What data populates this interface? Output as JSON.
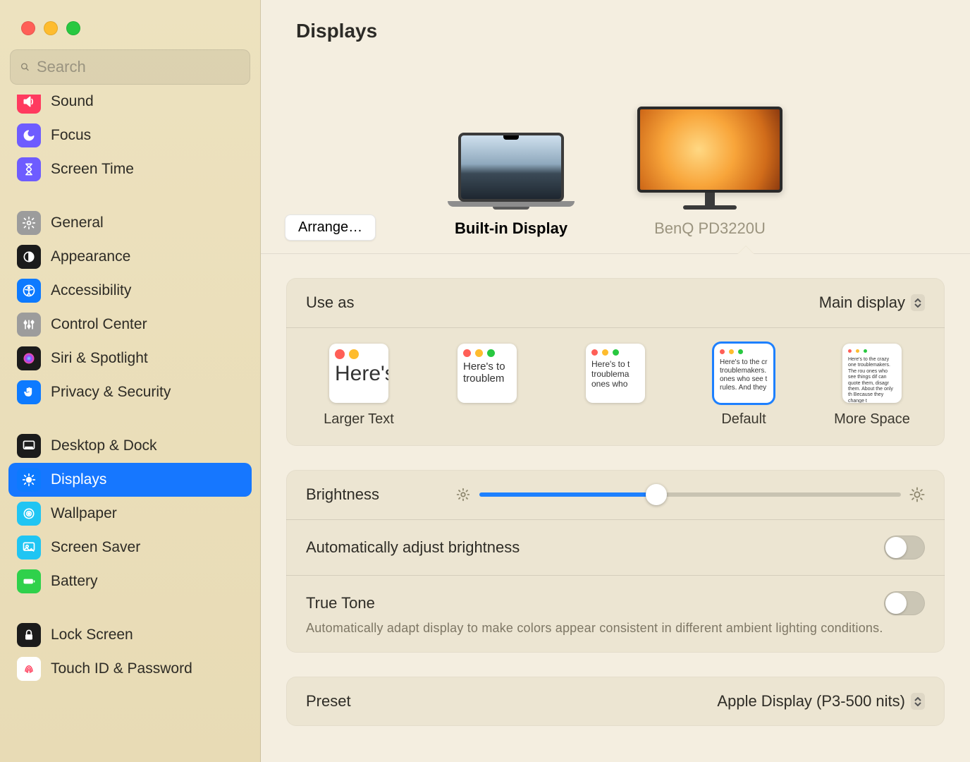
{
  "window": {
    "title": "Displays"
  },
  "search": {
    "placeholder": "Search"
  },
  "sidebar": {
    "items": [
      {
        "label": "Sound",
        "icon": "sound",
        "bg": "#ff3a5f"
      },
      {
        "label": "Focus",
        "icon": "moon",
        "bg": "#6e5cff"
      },
      {
        "label": "Screen Time",
        "icon": "hourglass",
        "bg": "#6e5cff"
      }
    ],
    "items2": [
      {
        "label": "General",
        "icon": "gear",
        "bg": "#9c9c9c"
      },
      {
        "label": "Appearance",
        "icon": "appearance",
        "bg": "#1b1b1b"
      },
      {
        "label": "Accessibility",
        "icon": "accessibility",
        "bg": "#0d7aff"
      },
      {
        "label": "Control Center",
        "icon": "control",
        "bg": "#9c9c9c"
      },
      {
        "label": "Siri & Spotlight",
        "icon": "siri",
        "bg": "#1b1b1b"
      },
      {
        "label": "Privacy & Security",
        "icon": "hand",
        "bg": "#0d7aff"
      }
    ],
    "items3": [
      {
        "label": "Desktop & Dock",
        "icon": "dock",
        "bg": "#1b1b1b"
      },
      {
        "label": "Displays",
        "icon": "displays",
        "bg": "#0d7aff",
        "selected": true
      },
      {
        "label": "Wallpaper",
        "icon": "wallpaper",
        "bg": "#20c5f3"
      },
      {
        "label": "Screen Saver",
        "icon": "screensaver",
        "bg": "#20c5f3"
      },
      {
        "label": "Battery",
        "icon": "battery",
        "bg": "#2fd14b"
      }
    ],
    "items4": [
      {
        "label": "Lock Screen",
        "icon": "lock",
        "bg": "#1b1b1b"
      },
      {
        "label": "Touch ID & Password",
        "icon": "touchid",
        "bg": "#ffffff"
      }
    ]
  },
  "picker": {
    "arrange": "Arrange…",
    "displays": [
      {
        "label": "Built-in Display",
        "active": true
      },
      {
        "label": "BenQ PD3220U",
        "active": false
      }
    ]
  },
  "use_as": {
    "label": "Use as",
    "value": "Main display"
  },
  "resolution": {
    "options": [
      {
        "label": "Larger Text",
        "sample": "Here's"
      },
      {
        "label": "",
        "sample": "Here's to troublem"
      },
      {
        "label": "",
        "sample": "Here's to t troublema ones who"
      },
      {
        "label": "Default",
        "sample": "Here's to the cr troublemakers. ones who see t rules. And they",
        "selected": true
      },
      {
        "label": "More Space",
        "sample": "Here's to the crazy one troublemakers. The rou ones who see things dif can quote them, disagr them. About the only th Because they change t"
      }
    ]
  },
  "brightness": {
    "label": "Brightness",
    "value_pct": 42
  },
  "auto_bright": {
    "label": "Automatically adjust brightness",
    "on": false
  },
  "truetone": {
    "label": "True Tone",
    "desc": "Automatically adapt display to make colors appear consistent in different ambient lighting conditions.",
    "on": false
  },
  "preset": {
    "label": "Preset",
    "value": "Apple Display (P3-500 nits)"
  }
}
